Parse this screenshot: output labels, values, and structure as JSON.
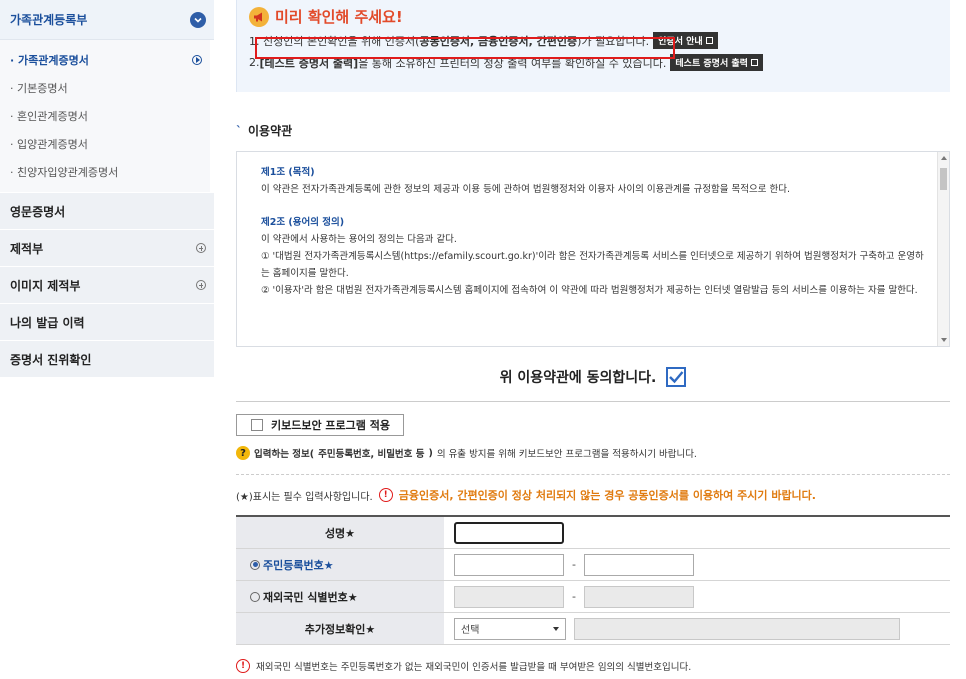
{
  "sidebar": {
    "header": "가족관계등록부",
    "sub_items": [
      {
        "label": "· 가족관계증명서",
        "active": true
      },
      {
        "label": "· 기본증명서"
      },
      {
        "label": "· 혼인관계증명서"
      },
      {
        "label": "· 입양관계증명서"
      },
      {
        "label": "· 친양자입양관계증명서"
      }
    ],
    "menu": [
      {
        "label": "영문증명서",
        "expand": false
      },
      {
        "label": "제적부",
        "expand": true
      },
      {
        "label": "이미지 제적부",
        "expand": true
      },
      {
        "label": "나의 발급 이력",
        "expand": false
      },
      {
        "label": "증명서 진위확인",
        "expand": false
      }
    ]
  },
  "notice": {
    "title": "미리 확인해 주세요!",
    "line1_pre": "1. 신청인의 본인확인을 위해 인증서(",
    "line1_bold": "공동인증서, 금융인증서, 간편인증",
    "line1_post": ")가 필요합니다.",
    "line1_btn": "인증서 안내",
    "line2_pre": "2. ",
    "line2_bold": "[테스트 증명서 출력]",
    "line2_post": "을 통해 소유하신 프린터의 정상 출력 여부를 확인하실 수 있습니다.",
    "line2_btn": "테스트 증명서 출력"
  },
  "terms": {
    "section_title": "이용약관",
    "art1_title": "제1조 (목적)",
    "art1_body": "이 약관은 전자가족관계등록에 관한 정보의 제공과 이용 등에 관하여 법원행정처와 이용자 사이의 이용관계를 규정함을 목적으로 한다.",
    "art2_title": "제2조 (용어의 정의)",
    "art2_body": "이 약관에서 사용하는 용어의 정의는 다음과 같다.",
    "art2_item1": "① '대법원 전자가족관계등록시스템(https://efamily.scourt.go.kr)'이라 함은 전자가족관계등록 서비스를 인터넷으로 제공하기 위하여 법원행정처가 구축하고 운영하는 홈페이지를 말한다.",
    "art2_item2": "② '이용자'라 함은 대법원 전자가족관계등록시스템 홈페이지에 접속하여 이 약관에 따라 법원행정처가 제공하는 인터넷 열람발급 등의 서비스를 이용하는 자를 말한다."
  },
  "agree": {
    "label": "위 이용약관에 동의합니다.",
    "checked": true
  },
  "keyboard": {
    "button": "키보드보안 프로그램 적용",
    "note_bold1": "입력하는 정보(",
    "note_bold2": "주민등록번호, 비밀번호 등",
    "note_bold3": ")",
    "note_rest": "의 유출 방지를 위해 키보드보안 프로그램을 적용하시기 바랍니다."
  },
  "required": {
    "note": "(★)표시는 필수 입력사항입니다.",
    "warning": "금융인증서, 간편인증이 정상 처리되지 않는 경우 공동인증서를 이용하여 주시기 바랍니다."
  },
  "form": {
    "name_label": "성명★",
    "rrn_label": "주민등록번호★",
    "foreign_label": "재외국민 식별번호★",
    "extra_label": "추가정보확인★",
    "dash": "-",
    "select_value": "선택"
  },
  "footer_note": "재외국민 식별번호는 주민등록번호가 없는 재외국민이 인증서를 발급받을 때 부여받은 임의의 식별번호입니다."
}
